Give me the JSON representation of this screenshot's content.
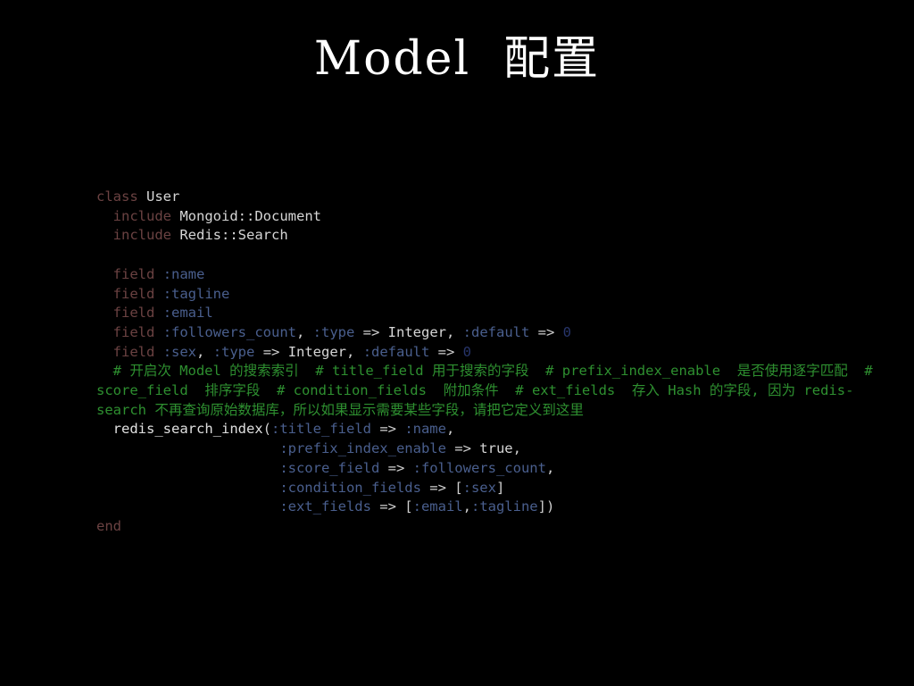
{
  "slide": {
    "title": "Model  配置",
    "background_color": "#000000",
    "title_color": "#ffffff"
  },
  "theme": {
    "keyword_color": "#6b4242",
    "identifier_color": "#d6d6d6",
    "symbol_color": "#4a5f8e",
    "number_color": "#27356b",
    "operator_color": "#cfcfcf",
    "comment_color": "#2e9030"
  },
  "code": {
    "language": "ruby",
    "lines": [
      {
        "id": "line-class-user",
        "indent": 0,
        "tokens": [
          {
            "t": "kw",
            "v": "class"
          },
          {
            "t": "op",
            "v": " "
          },
          {
            "t": "id",
            "v": "User"
          }
        ]
      },
      {
        "id": "line-include-mongoid",
        "indent": 1,
        "tokens": [
          {
            "t": "kw",
            "v": "include"
          },
          {
            "t": "op",
            "v": " "
          },
          {
            "t": "id",
            "v": "Mongoid::Document"
          }
        ]
      },
      {
        "id": "line-include-redis-search",
        "indent": 1,
        "tokens": [
          {
            "t": "kw",
            "v": "include"
          },
          {
            "t": "op",
            "v": " "
          },
          {
            "t": "id",
            "v": "Redis::Search"
          }
        ]
      },
      {
        "id": "line-blank-1",
        "indent": 0,
        "tokens": []
      },
      {
        "id": "line-field-name",
        "indent": 1,
        "tokens": [
          {
            "t": "kw",
            "v": "field"
          },
          {
            "t": "op",
            "v": " "
          },
          {
            "t": "sym",
            "v": ":name"
          }
        ]
      },
      {
        "id": "line-field-tagline",
        "indent": 1,
        "tokens": [
          {
            "t": "kw",
            "v": "field"
          },
          {
            "t": "op",
            "v": " "
          },
          {
            "t": "sym",
            "v": ":tagline"
          }
        ]
      },
      {
        "id": "line-field-email",
        "indent": 1,
        "tokens": [
          {
            "t": "kw",
            "v": "field"
          },
          {
            "t": "op",
            "v": " "
          },
          {
            "t": "sym",
            "v": ":email"
          }
        ]
      },
      {
        "id": "line-field-followers-count",
        "indent": 1,
        "tokens": [
          {
            "t": "kw",
            "v": "field"
          },
          {
            "t": "op",
            "v": " "
          },
          {
            "t": "sym",
            "v": ":followers_count"
          },
          {
            "t": "punc",
            "v": ", "
          },
          {
            "t": "sym",
            "v": ":type"
          },
          {
            "t": "op",
            "v": " => "
          },
          {
            "t": "id",
            "v": "Integer"
          },
          {
            "t": "punc",
            "v": ", "
          },
          {
            "t": "sym",
            "v": ":default"
          },
          {
            "t": "op",
            "v": " => "
          },
          {
            "t": "num",
            "v": "0"
          }
        ]
      },
      {
        "id": "line-field-sex",
        "indent": 1,
        "tokens": [
          {
            "t": "kw",
            "v": "field"
          },
          {
            "t": "op",
            "v": " "
          },
          {
            "t": "sym",
            "v": ":sex"
          },
          {
            "t": "punc",
            "v": ", "
          },
          {
            "t": "sym",
            "v": ":type"
          },
          {
            "t": "op",
            "v": " => "
          },
          {
            "t": "id",
            "v": "Integer"
          },
          {
            "t": "punc",
            "v": ", "
          },
          {
            "t": "sym",
            "v": ":default"
          },
          {
            "t": "op",
            "v": " => "
          },
          {
            "t": "num",
            "v": "0"
          }
        ]
      },
      {
        "id": "line-comment-block",
        "indent": 1,
        "comment": true,
        "text": "# 开启次 Model 的搜索索引  # title_field 用于搜索的字段  # prefix_index_enable  是否使用逐字匹配  # score_field  排序字段  # condition_fields  附加条件  # ext_fields  存入 Hash 的字段, 因为 redis-search 不再查询原始数据库，所以如果显示需要某些字段，请把它定义到这里"
      },
      {
        "id": "line-redis-search-index-open",
        "indent": 1,
        "tokens": [
          {
            "t": "meth",
            "v": "redis_search_index"
          },
          {
            "t": "punc",
            "v": "("
          },
          {
            "t": "sym",
            "v": ":title_field"
          },
          {
            "t": "op",
            "v": " => "
          },
          {
            "t": "sym",
            "v": ":name"
          },
          {
            "t": "punc",
            "v": ","
          }
        ]
      },
      {
        "id": "line-prefix-index-enable",
        "indent": 0,
        "pad": 22,
        "tokens": [
          {
            "t": "sym",
            "v": ":prefix_index_enable"
          },
          {
            "t": "op",
            "v": " => "
          },
          {
            "t": "id",
            "v": "true"
          },
          {
            "t": "punc",
            "v": ","
          }
        ]
      },
      {
        "id": "line-score-field",
        "indent": 0,
        "pad": 22,
        "tokens": [
          {
            "t": "sym",
            "v": ":score_field"
          },
          {
            "t": "op",
            "v": " => "
          },
          {
            "t": "sym",
            "v": ":followers_count"
          },
          {
            "t": "punc",
            "v": ","
          }
        ]
      },
      {
        "id": "line-condition-fields",
        "indent": 0,
        "pad": 22,
        "tokens": [
          {
            "t": "sym",
            "v": ":condition_fields"
          },
          {
            "t": "op",
            "v": " => "
          },
          {
            "t": "punc",
            "v": "["
          },
          {
            "t": "sym",
            "v": ":sex"
          },
          {
            "t": "punc",
            "v": "]"
          }
        ]
      },
      {
        "id": "line-ext-fields",
        "indent": 0,
        "pad": 22,
        "tokens": [
          {
            "t": "sym",
            "v": ":ext_fields"
          },
          {
            "t": "op",
            "v": " => "
          },
          {
            "t": "punc",
            "v": "["
          },
          {
            "t": "sym",
            "v": ":email"
          },
          {
            "t": "punc",
            "v": ","
          },
          {
            "t": "sym",
            "v": ":tagline"
          },
          {
            "t": "punc",
            "v": "])"
          }
        ]
      },
      {
        "id": "line-end",
        "indent": 0,
        "tokens": [
          {
            "t": "kw",
            "v": "end"
          }
        ]
      }
    ]
  }
}
